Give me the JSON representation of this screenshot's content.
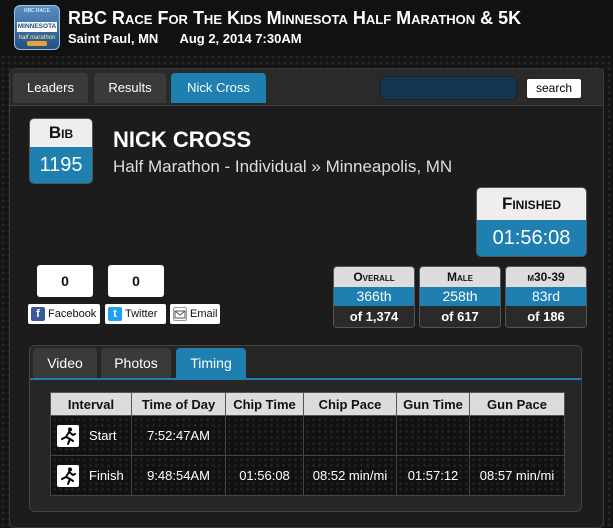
{
  "header": {
    "logo_line1": "RBC RACE",
    "logo_line2": "MINNESOTA",
    "logo_line3": "half marathon",
    "title": "RBC Race For The Kids Minnesota Half Marathon & 5K",
    "location": "Saint Paul, MN",
    "datetime": "Aug 2, 2014 7:30AM"
  },
  "nav": {
    "tabs": [
      {
        "label": "Leaders"
      },
      {
        "label": "Results"
      },
      {
        "label": "Nick Cross",
        "active": true
      }
    ],
    "search_value": "",
    "search_label": "search"
  },
  "athlete": {
    "bib_label": "Bib",
    "bib": "1195",
    "name": "NICK CROSS",
    "race": "Half Marathon - Individual » Minneapolis, MN",
    "finished_label": "Finished",
    "finish_time": "01:56:08"
  },
  "ranks": [
    {
      "label": "Overall",
      "place": "366th",
      "of": "of 1,374"
    },
    {
      "label": "Male",
      "place": "258th",
      "of": "of 617"
    },
    {
      "label": "m30-39",
      "place": "83rd",
      "of": "of 186"
    }
  ],
  "social": {
    "facebook_count": "0",
    "twitter_count": "0",
    "facebook_label": "Facebook",
    "twitter_label": "Twitter",
    "email_label": "Email"
  },
  "subtabs": [
    {
      "label": "Video"
    },
    {
      "label": "Photos"
    },
    {
      "label": "Timing",
      "active": true
    }
  ],
  "timing": {
    "headers": [
      "Interval",
      "Time of Day",
      "Chip Time",
      "Chip Pace",
      "Gun Time",
      "Gun Pace"
    ],
    "rows": [
      {
        "icon": "runner-icon",
        "interval": "Start",
        "time_of_day": "7:52:47AM",
        "chip_time": "",
        "chip_pace": "",
        "gun_time": "",
        "gun_pace": ""
      },
      {
        "icon": "runner-icon",
        "interval": "Finish",
        "time_of_day": "9:48:54AM",
        "chip_time": "01:56:08",
        "chip_pace": "08:52 min/mi",
        "gun_time": "01:57:12",
        "gun_pace": "08:57 min/mi"
      }
    ]
  },
  "colors": {
    "accent": "#1e7fb0",
    "background": "#141414"
  }
}
